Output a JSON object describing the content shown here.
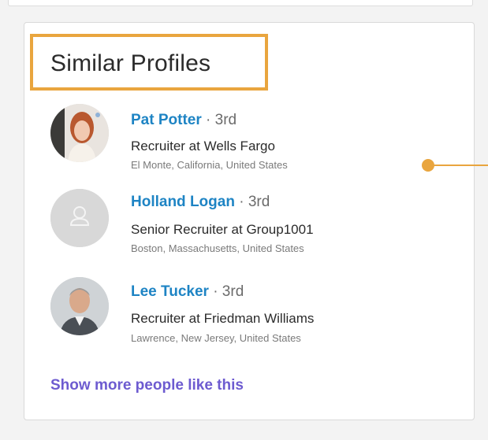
{
  "card": {
    "title": "Similar Profiles",
    "show_more_label": "Show more people like this"
  },
  "profiles": [
    {
      "name": "Pat Potter",
      "degree": " · 3rd",
      "headline": "Recruiter at Wells Fargo",
      "location": "El Monte, California, United States",
      "avatar": "photo"
    },
    {
      "name": "Holland Logan",
      "degree": " · 3rd",
      "headline": "Senior Recruiter at Group1001",
      "location": "Boston, Massachusetts, United States",
      "avatar": "placeholder-person-icon"
    },
    {
      "name": "Lee Tucker",
      "degree": " · 3rd",
      "headline": "Recruiter at Friedman Williams",
      "location": "Lawrence, New Jersey, United States",
      "avatar": "photo"
    }
  ],
  "colors": {
    "highlight": "#e9a53e",
    "name_link": "#1e84c4",
    "show_more": "#6d5bd0",
    "title_text": "#2b2b2b"
  }
}
